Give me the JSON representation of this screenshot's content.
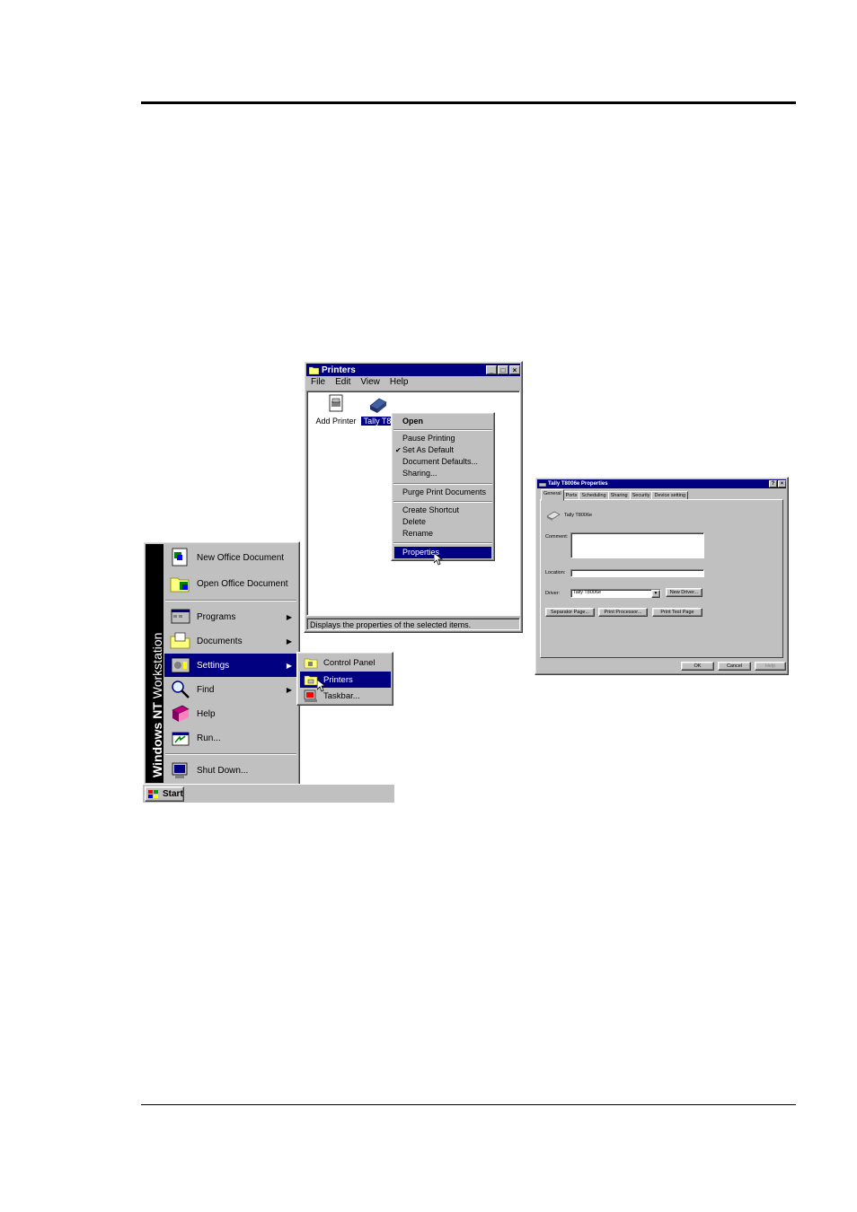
{
  "printers_window": {
    "title": "Printers",
    "menu": [
      "File",
      "Edit",
      "View",
      "Help"
    ],
    "icons": [
      {
        "label": "Add Printer",
        "icon": "add-printer-icon"
      },
      {
        "label": "Tally T8",
        "icon": "printer-icon",
        "selected": true
      }
    ],
    "status": "Displays the properties of the selected items."
  },
  "context_menu": {
    "items": [
      {
        "label": "Open",
        "bold": true
      },
      {
        "label": "Pause Printing"
      },
      {
        "label": "Set As Default",
        "checked": true
      },
      {
        "label": "Document Defaults..."
      },
      {
        "label": "Sharing..."
      },
      {
        "label": "Purge Print Documents"
      },
      {
        "label": "Create Shortcut"
      },
      {
        "label": "Delete"
      },
      {
        "label": "Rename"
      },
      {
        "label": "Properties",
        "highlighted": true
      }
    ]
  },
  "properties_dialog": {
    "title": "Tally T8006e Properties",
    "tabs": [
      "General",
      "Ports",
      "Scheduling",
      "Sharing",
      "Security",
      "Device setting"
    ],
    "active_tab": "General",
    "printer_name": "Tally T8006e",
    "comment_label": "Comment:",
    "location_label": "Location:",
    "driver_label": "Driver:",
    "driver_value": "Tally T8006e",
    "new_driver_button": "New Driver...",
    "separator_button": "Separator Page...",
    "processor_button": "Print Processor...",
    "test_page_button": "Print Test Page",
    "ok_button": "OK",
    "cancel_button": "Cancel",
    "help_button": "Help"
  },
  "start_menu": {
    "banner_bold": "Windows NT",
    "banner_light": " Workstation",
    "items": [
      {
        "label": "New Office Document"
      },
      {
        "label": "Open Office Document"
      },
      {
        "label": "Programs",
        "submenu": true
      },
      {
        "label": "Documents",
        "submenu": true
      },
      {
        "label": "Settings",
        "submenu": true,
        "highlighted": true
      },
      {
        "label": "Find",
        "submenu": true
      },
      {
        "label": "Help"
      },
      {
        "label": "Run..."
      },
      {
        "label": "Shut Down..."
      }
    ]
  },
  "settings_submenu": {
    "items": [
      {
        "label": "Control Panel"
      },
      {
        "label": "Printers",
        "highlighted": true
      },
      {
        "label": "Taskbar..."
      }
    ]
  },
  "taskbar": {
    "start_label": "Start"
  }
}
